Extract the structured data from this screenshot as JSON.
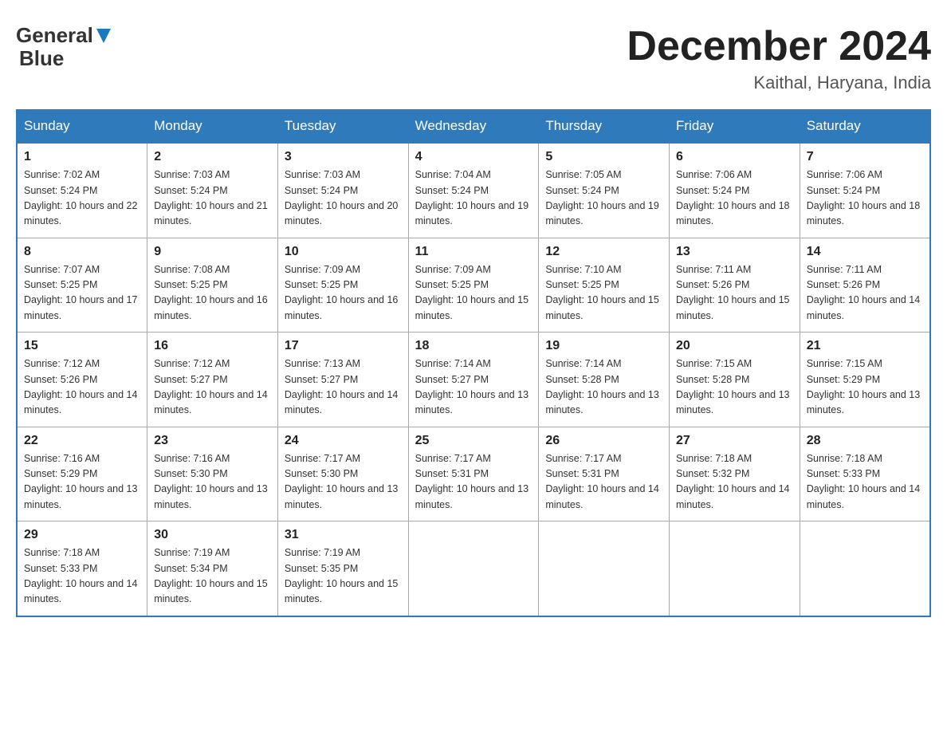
{
  "header": {
    "logo_main": "General",
    "logo_sub": "Blue",
    "month_title": "December 2024",
    "location": "Kaithal, Haryana, India"
  },
  "columns": [
    "Sunday",
    "Monday",
    "Tuesday",
    "Wednesday",
    "Thursday",
    "Friday",
    "Saturday"
  ],
  "weeks": [
    [
      {
        "day": "1",
        "sunrise": "7:02 AM",
        "sunset": "5:24 PM",
        "daylight": "10 hours and 22 minutes."
      },
      {
        "day": "2",
        "sunrise": "7:03 AM",
        "sunset": "5:24 PM",
        "daylight": "10 hours and 21 minutes."
      },
      {
        "day": "3",
        "sunrise": "7:03 AM",
        "sunset": "5:24 PM",
        "daylight": "10 hours and 20 minutes."
      },
      {
        "day": "4",
        "sunrise": "7:04 AM",
        "sunset": "5:24 PM",
        "daylight": "10 hours and 19 minutes."
      },
      {
        "day": "5",
        "sunrise": "7:05 AM",
        "sunset": "5:24 PM",
        "daylight": "10 hours and 19 minutes."
      },
      {
        "day": "6",
        "sunrise": "7:06 AM",
        "sunset": "5:24 PM",
        "daylight": "10 hours and 18 minutes."
      },
      {
        "day": "7",
        "sunrise": "7:06 AM",
        "sunset": "5:24 PM",
        "daylight": "10 hours and 18 minutes."
      }
    ],
    [
      {
        "day": "8",
        "sunrise": "7:07 AM",
        "sunset": "5:25 PM",
        "daylight": "10 hours and 17 minutes."
      },
      {
        "day": "9",
        "sunrise": "7:08 AM",
        "sunset": "5:25 PM",
        "daylight": "10 hours and 16 minutes."
      },
      {
        "day": "10",
        "sunrise": "7:09 AM",
        "sunset": "5:25 PM",
        "daylight": "10 hours and 16 minutes."
      },
      {
        "day": "11",
        "sunrise": "7:09 AM",
        "sunset": "5:25 PM",
        "daylight": "10 hours and 15 minutes."
      },
      {
        "day": "12",
        "sunrise": "7:10 AM",
        "sunset": "5:25 PM",
        "daylight": "10 hours and 15 minutes."
      },
      {
        "day": "13",
        "sunrise": "7:11 AM",
        "sunset": "5:26 PM",
        "daylight": "10 hours and 15 minutes."
      },
      {
        "day": "14",
        "sunrise": "7:11 AM",
        "sunset": "5:26 PM",
        "daylight": "10 hours and 14 minutes."
      }
    ],
    [
      {
        "day": "15",
        "sunrise": "7:12 AM",
        "sunset": "5:26 PM",
        "daylight": "10 hours and 14 minutes."
      },
      {
        "day": "16",
        "sunrise": "7:12 AM",
        "sunset": "5:27 PM",
        "daylight": "10 hours and 14 minutes."
      },
      {
        "day": "17",
        "sunrise": "7:13 AM",
        "sunset": "5:27 PM",
        "daylight": "10 hours and 14 minutes."
      },
      {
        "day": "18",
        "sunrise": "7:14 AM",
        "sunset": "5:27 PM",
        "daylight": "10 hours and 13 minutes."
      },
      {
        "day": "19",
        "sunrise": "7:14 AM",
        "sunset": "5:28 PM",
        "daylight": "10 hours and 13 minutes."
      },
      {
        "day": "20",
        "sunrise": "7:15 AM",
        "sunset": "5:28 PM",
        "daylight": "10 hours and 13 minutes."
      },
      {
        "day": "21",
        "sunrise": "7:15 AM",
        "sunset": "5:29 PM",
        "daylight": "10 hours and 13 minutes."
      }
    ],
    [
      {
        "day": "22",
        "sunrise": "7:16 AM",
        "sunset": "5:29 PM",
        "daylight": "10 hours and 13 minutes."
      },
      {
        "day": "23",
        "sunrise": "7:16 AM",
        "sunset": "5:30 PM",
        "daylight": "10 hours and 13 minutes."
      },
      {
        "day": "24",
        "sunrise": "7:17 AM",
        "sunset": "5:30 PM",
        "daylight": "10 hours and 13 minutes."
      },
      {
        "day": "25",
        "sunrise": "7:17 AM",
        "sunset": "5:31 PM",
        "daylight": "10 hours and 13 minutes."
      },
      {
        "day": "26",
        "sunrise": "7:17 AM",
        "sunset": "5:31 PM",
        "daylight": "10 hours and 14 minutes."
      },
      {
        "day": "27",
        "sunrise": "7:18 AM",
        "sunset": "5:32 PM",
        "daylight": "10 hours and 14 minutes."
      },
      {
        "day": "28",
        "sunrise": "7:18 AM",
        "sunset": "5:33 PM",
        "daylight": "10 hours and 14 minutes."
      }
    ],
    [
      {
        "day": "29",
        "sunrise": "7:18 AM",
        "sunset": "5:33 PM",
        "daylight": "10 hours and 14 minutes."
      },
      {
        "day": "30",
        "sunrise": "7:19 AM",
        "sunset": "5:34 PM",
        "daylight": "10 hours and 15 minutes."
      },
      {
        "day": "31",
        "sunrise": "7:19 AM",
        "sunset": "5:35 PM",
        "daylight": "10 hours and 15 minutes."
      },
      null,
      null,
      null,
      null
    ]
  ]
}
